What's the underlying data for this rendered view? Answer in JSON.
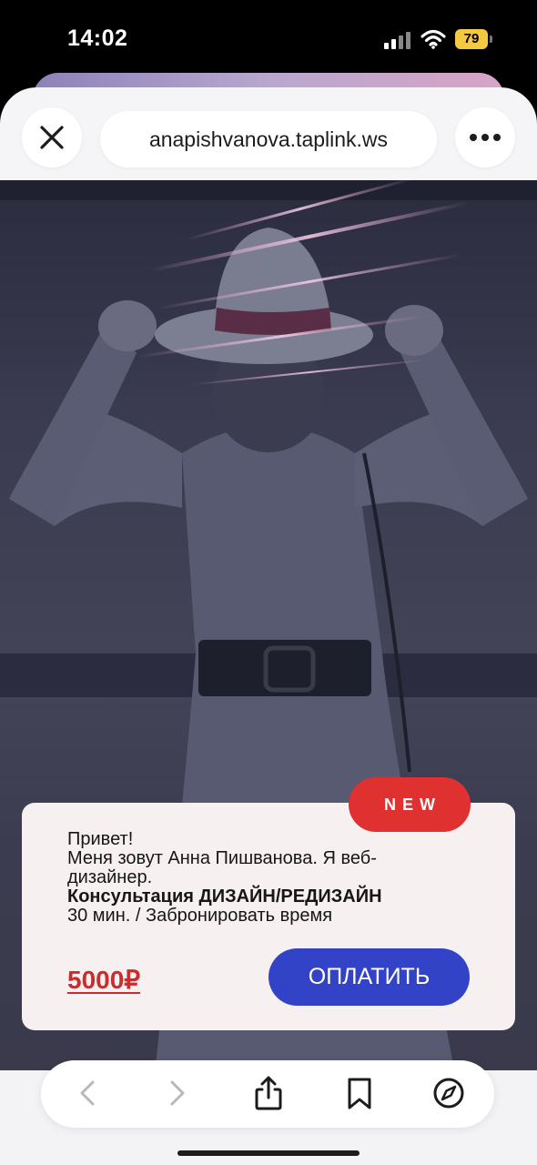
{
  "status_bar": {
    "time": "14:02",
    "battery": "79",
    "icons": [
      "signal-icon",
      "wifi-icon",
      "battery-icon"
    ]
  },
  "browser": {
    "url": "anapishvanova.taplink.ws",
    "close_icon": "close-icon",
    "more_icon": "more-icon"
  },
  "card": {
    "badge": "NEW",
    "lines": [
      "Привет!",
      "Меня зовут Анна Пишванова. Я веб-",
      "дизайнер.",
      "Консультация ДИЗАЙН/РЕДИЗАЙН",
      "30 мин. / Забронировать время"
    ],
    "price": "5000₽",
    "pay_label": "ОПЛАТИТЬ"
  },
  "toolbar": {
    "icons": [
      "back-icon",
      "forward-icon",
      "share-icon",
      "bookmarks-icon",
      "compass-icon"
    ]
  },
  "colors": {
    "badge": "#e03131",
    "price": "#c92d2d",
    "pay_button": "#3343c7",
    "card_bg": "#f6f0f0"
  }
}
